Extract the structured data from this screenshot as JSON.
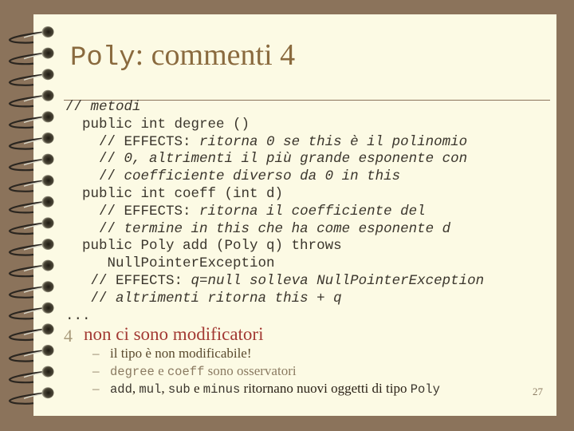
{
  "slide": {
    "title_mono": "Poly",
    "title_text": ": commenti 4",
    "code_lines": [
      {
        "indent": "",
        "plain": "// ",
        "italic": "metodi"
      },
      {
        "indent": "  ",
        "plain": "public int degree ()",
        "italic": ""
      },
      {
        "indent": "    ",
        "plain": "// EFFECTS: ",
        "italic": "ritorna 0 se this è il polinomio"
      },
      {
        "indent": "    ",
        "plain": "// ",
        "italic": "0, altrimenti il più grande esponente con"
      },
      {
        "indent": "    ",
        "plain": "// ",
        "italic": "coefficiente diverso da 0 in this"
      },
      {
        "indent": "  ",
        "plain": "public int coeff (int d)",
        "italic": ""
      },
      {
        "indent": "    ",
        "plain": "// EFFECTS: ",
        "italic": "ritorna il coefficiente del"
      },
      {
        "indent": "    ",
        "plain": "// ",
        "italic": "termine in this che ha come esponente d"
      },
      {
        "indent": "  ",
        "plain": "public Poly add (Poly q) throws",
        "italic": ""
      },
      {
        "indent": "     ",
        "plain": "NullPointerException",
        "italic": ""
      },
      {
        "indent": "   ",
        "plain": "// EFFECTS: ",
        "italic": "q=null solleva NullPointerException"
      },
      {
        "indent": "   ",
        "plain": "// ",
        "italic": "altrimenti ritorna this + q"
      },
      {
        "indent": "",
        "plain": "...",
        "italic": ""
      }
    ],
    "bullet_marker": "4",
    "bullet_text": "non ci sono modificatori",
    "sub_dash": "–",
    "sub1": "il tipo è non modificabile!",
    "sub2": {
      "m1": "degree",
      "t1": " e ",
      "m2": "coeff",
      "t2": " sono osservatori"
    },
    "sub3": {
      "m1": "add",
      "t1": ", ",
      "m2": "mul",
      "t2": ", ",
      "m3": "sub",
      "t3": " e ",
      "m4": "minus",
      "t4": " ritornano nuovi oggetti di tipo ",
      "m5": "Poly"
    },
    "page_number": "27"
  },
  "colors": {
    "background": "#8b735b",
    "page": "#fcfae4",
    "title": "#8a6a3e",
    "bullet": "#a33a34"
  }
}
